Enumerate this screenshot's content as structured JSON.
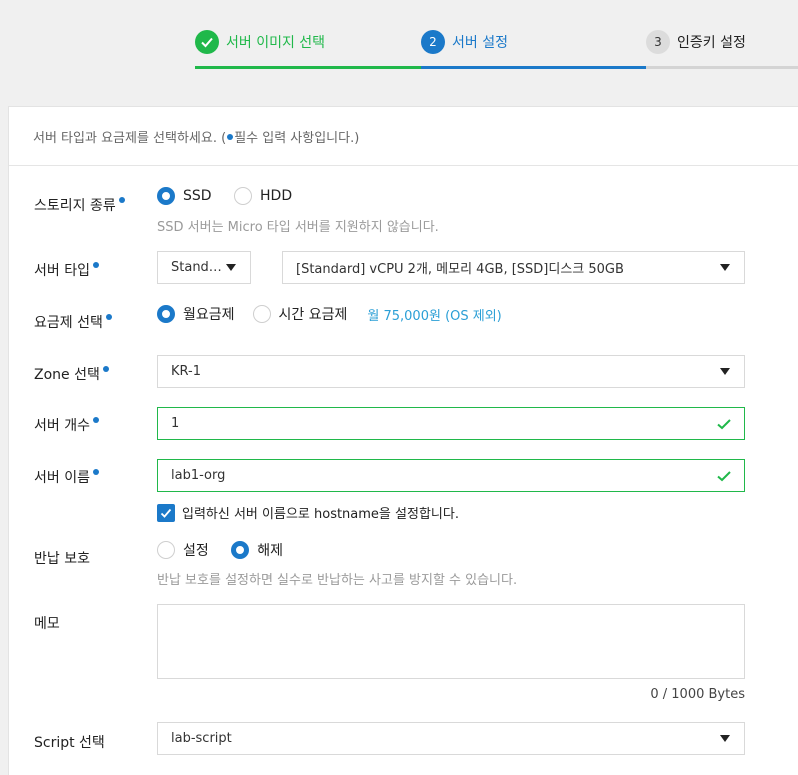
{
  "stepper": {
    "step1": {
      "label": "서버 이미지 선택"
    },
    "step2": {
      "number": "2",
      "label": "서버 설정"
    },
    "step3": {
      "number": "3",
      "label": "인증키 설정"
    }
  },
  "panel": {
    "intro_before": "서버 타입과 요금제를 선택하세요. (",
    "intro_after": "필수 입력 사항입니다.)"
  },
  "storage": {
    "label": "스토리지 종류",
    "options": [
      "SSD",
      "HDD"
    ],
    "selected": "SSD",
    "hint": "SSD 서버는 Micro 타입 서버를 지원하지 않습니다."
  },
  "server_type": {
    "label": "서버 타입",
    "category": "Stand…",
    "spec": "[Standard] vCPU 2개, 메모리 4GB, [SSD]디스크 50GB"
  },
  "pricing": {
    "label": "요금제 선택",
    "options": [
      "월요금제",
      "시간 요금제"
    ],
    "selected": "월요금제",
    "price": "월 75,000원 (OS 제외)"
  },
  "zone": {
    "label": "Zone 선택",
    "value": "KR-1"
  },
  "server_count": {
    "label": "서버 개수",
    "value": "1"
  },
  "server_name": {
    "label": "서버 이름",
    "value": "lab1-org",
    "hostname_checkbox": "입력하신 서버 이름으로 hostname을 설정합니다."
  },
  "return_protection": {
    "label": "반납 보호",
    "options": [
      "설정",
      "해제"
    ],
    "selected": "해제",
    "hint": "반납 보호를 설정하면 실수로 반납하는 사고를 방지할 수 있습니다."
  },
  "memo": {
    "label": "메모",
    "value": "",
    "counter": "0 / 1000 Bytes"
  },
  "script": {
    "label": "Script 선택",
    "value": "lab-script"
  },
  "colors": {
    "accent": "#1b79c9",
    "success": "#20b84a"
  }
}
